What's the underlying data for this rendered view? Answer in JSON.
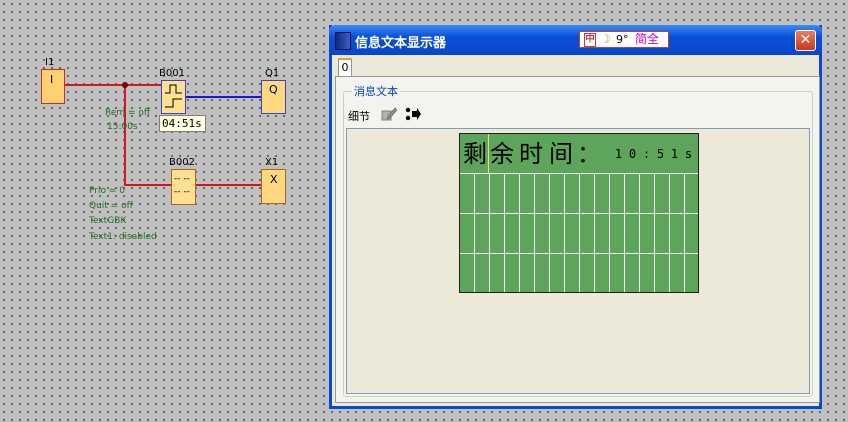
{
  "diagram": {
    "blocks": {
      "i1": {
        "name": "I1",
        "text": "I"
      },
      "b001": {
        "name": "B001",
        "params": [
          "Rem = off",
          "15:00s"
        ],
        "tooltip": "04:51s"
      },
      "q1": {
        "name": "Q1",
        "text": "Q"
      },
      "b002": {
        "name": "B002",
        "text_top": "-- --",
        "text_bottom": "-- --",
        "params": [
          "Prio = 0",
          "Quit = off",
          "TextGBK",
          "Text1: disabled"
        ]
      },
      "x1": {
        "name": "X1",
        "text": "X"
      }
    }
  },
  "window": {
    "title": "信息文本显示器",
    "ime": {
      "icon_text": "中",
      "moon": "☽",
      "symbol": "9°",
      "label": "简全"
    },
    "close_symbol": "✕",
    "tab": "0",
    "group_title": "消息文本",
    "detail_label": "细节",
    "icons": {
      "edit": "edit-pencil-icon",
      "move": "move-arrows-icon"
    },
    "lcd": {
      "big_chars": [
        "剩",
        "余",
        "时",
        "间",
        "："
      ],
      "small_chars": [
        "1",
        "0",
        ":",
        "5",
        "1",
        "s"
      ]
    }
  },
  "colors": {
    "lcd_background": "#5ca55a",
    "titlebar": "#0a50d8",
    "wire_red": "#d01818",
    "wire_blue": "#1818d0"
  }
}
